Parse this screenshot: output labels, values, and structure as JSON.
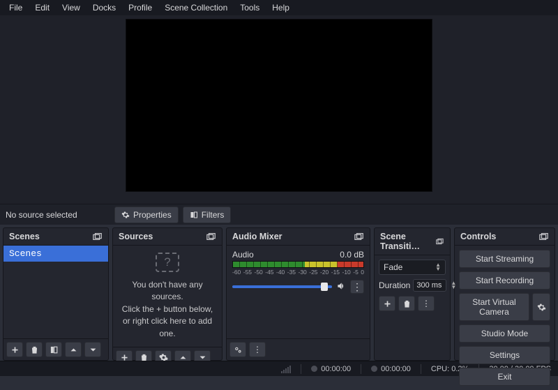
{
  "menu": [
    "File",
    "Edit",
    "View",
    "Docks",
    "Profile",
    "Scene Collection",
    "Tools",
    "Help"
  ],
  "toolbar": {
    "status": "No source selected",
    "properties": "Properties",
    "filters": "Filters"
  },
  "docks": {
    "scenes": {
      "title": "Scenes",
      "items": [
        "Scenes"
      ]
    },
    "sources": {
      "title": "Sources",
      "empty1": "You don't have any sources.",
      "empty2": "Click the + button below,",
      "empty3": "or right click here to add one."
    },
    "mixer": {
      "title": "Audio Mixer",
      "channel": "Audio",
      "level": "0.0 dB",
      "ticks": [
        "-60",
        "-55",
        "-50",
        "-45",
        "-40",
        "-35",
        "-30",
        "-25",
        "-20",
        "-15",
        "-10",
        "-5",
        "0"
      ]
    },
    "transitions": {
      "title": "Scene Transiti…",
      "current": "Fade",
      "duration_label": "Duration",
      "duration_value": "300 ms"
    },
    "controls": {
      "title": "Controls",
      "start_streaming": "Start Streaming",
      "start_recording": "Start Recording",
      "start_vcam": "Start Virtual Camera",
      "studio_mode": "Studio Mode",
      "settings": "Settings",
      "exit": "Exit"
    }
  },
  "statusbar": {
    "live_time": "00:00:00",
    "rec_time": "00:00:00",
    "cpu": "CPU: 0.2%",
    "fps": "30.00 / 30.00 FPS"
  }
}
